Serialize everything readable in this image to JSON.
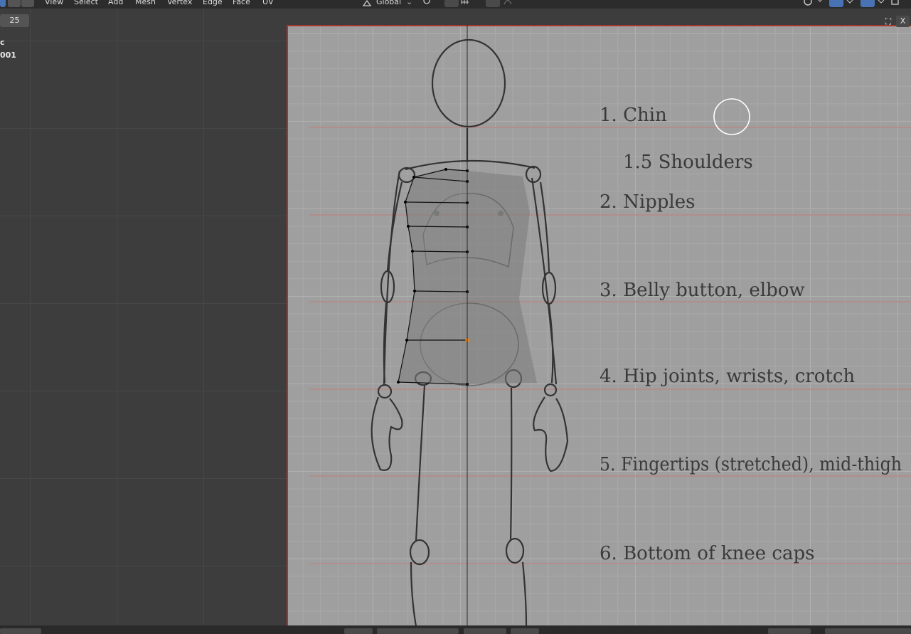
{
  "header": {
    "menus": [
      {
        "label": "View"
      },
      {
        "label": "Select"
      },
      {
        "label": "Add"
      },
      {
        "label": "Mesh"
      },
      {
        "label": "Vertex"
      },
      {
        "label": "Edge"
      },
      {
        "label": "Face"
      },
      {
        "label": "UV"
      }
    ],
    "transform_orientation": "Global"
  },
  "viewport": {
    "frame_value": "25",
    "stats": [
      "c",
      "001"
    ]
  },
  "gizmo": {
    "close_label": "X"
  },
  "reference": {
    "labels": [
      {
        "text": "1. Chin"
      },
      {
        "text": "1.5 Shoulders"
      },
      {
        "text": "2. Nipples"
      },
      {
        "text": "3. Belly button, elbow"
      },
      {
        "text": "4. Hip joints, wrists, crotch"
      },
      {
        "text": "5. Fingertips (stretched), mid-thigh"
      },
      {
        "text": "6. Bottom of knee caps"
      }
    ]
  },
  "colors": {
    "camera_border": "#a5352f",
    "guide_line": "#b08e8c",
    "selected_vertex": "#ff8a00"
  }
}
